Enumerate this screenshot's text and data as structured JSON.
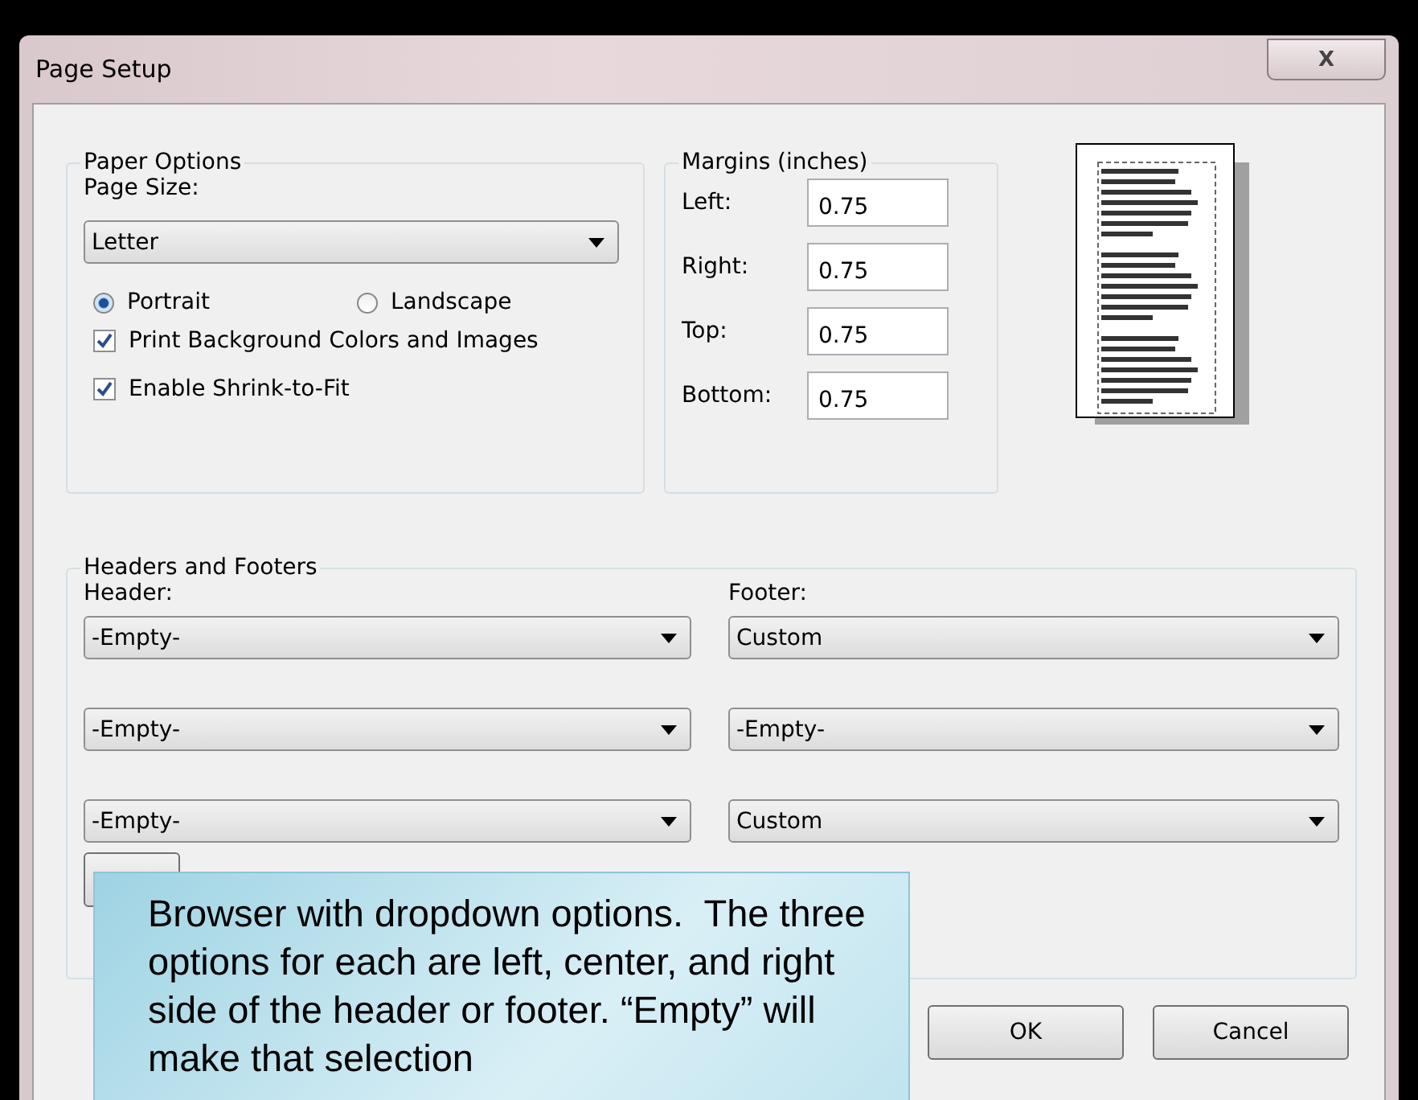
{
  "window": {
    "title": "Page Setup",
    "close": "X"
  },
  "paper_options": {
    "title": "Paper Options",
    "page_size_label": "Page Size:",
    "page_size": "Letter",
    "orientation": [
      {
        "label": "Portrait",
        "selected": true
      },
      {
        "label": "Landscape",
        "selected": false
      }
    ],
    "checkboxes": [
      {
        "label": "Print Background Colors and Images",
        "checked": true
      },
      {
        "label": "Enable Shrink-to-Fit",
        "checked": true
      }
    ]
  },
  "margins": {
    "title": "Margins (inches)",
    "fields": [
      {
        "label": "Left:",
        "value": "0.75"
      },
      {
        "label": "Right:",
        "value": "0.75"
      },
      {
        "label": "Top:",
        "value": "0.75"
      },
      {
        "label": "Bottom:",
        "value": "0.75"
      }
    ]
  },
  "headers_footers": {
    "title": "Headers and Footers",
    "header_label": "Header:",
    "footer_label": "Footer:",
    "header": [
      "-Empty-",
      "-Empty-",
      "-Empty-"
    ],
    "footer": [
      "Custom",
      "-Empty-",
      "Custom"
    ]
  },
  "buttons": [
    "OK",
    "Cancel"
  ],
  "callout": "Browser with dropdown options.  The three options for each are left, center, and right side of the header or footer. “Empty” will make that selection"
}
